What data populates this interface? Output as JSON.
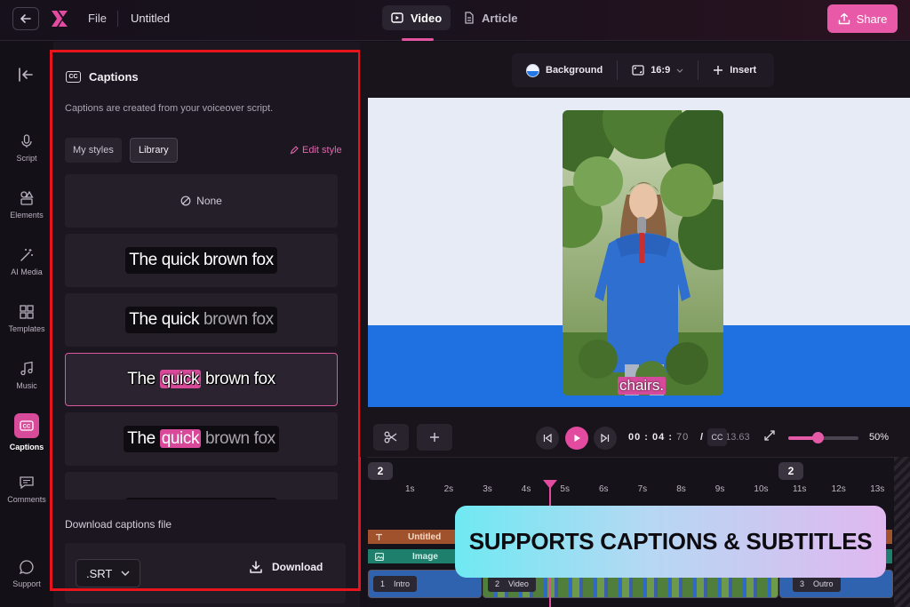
{
  "header": {
    "file_menu": "File",
    "doc_title": "Untitled",
    "tabs": [
      {
        "label": "Video",
        "active": true
      },
      {
        "label": "Article",
        "active": false
      }
    ],
    "share_label": "Share",
    "accent_color": "#e85aa7"
  },
  "rail": {
    "items": [
      {
        "label": "Script",
        "icon": "mic-icon"
      },
      {
        "label": "Elements",
        "icon": "shapes-icon"
      },
      {
        "label": "AI Media",
        "icon": "magic-wand-icon"
      },
      {
        "label": "Templates",
        "icon": "templates-icon"
      },
      {
        "label": "Music",
        "icon": "music-note-icon"
      },
      {
        "label": "Captions",
        "icon": "cc-icon",
        "active": true
      },
      {
        "label": "Comments",
        "icon": "comment-icon"
      },
      {
        "label": "Support",
        "icon": "chat-bubble-icon"
      }
    ]
  },
  "captions_panel": {
    "title": "Captions",
    "description": "Captions are created from your voiceover script.",
    "segments": [
      "My styles",
      "Library"
    ],
    "active_segment": "Library",
    "edit_style_label": "Edit style",
    "none_label": "None",
    "sample_words": [
      "The",
      "quick",
      "brown",
      "fox"
    ],
    "download_label": "Download captions file",
    "format_value": ".SRT",
    "download_button": "Download"
  },
  "canvas_toolbar": {
    "background_label": "Background",
    "aspect_ratio": "16:9",
    "insert_label": "Insert"
  },
  "canvas": {
    "subtitle": "chairs."
  },
  "playback": {
    "time_min": "00",
    "time_sec": "04",
    "time_ms": "70",
    "separator": "/",
    "total_time": "13.63",
    "zoom_percent": "50%",
    "zoom_fraction": 0.42
  },
  "timeline": {
    "markers": [
      "2",
      "2"
    ],
    "ticks": [
      "1s",
      "2s",
      "3s",
      "4s",
      "5s",
      "6s",
      "7s",
      "8s",
      "9s",
      "10s",
      "11s",
      "12s",
      "13s"
    ],
    "tracks": {
      "text_label": "Untitled",
      "image_label": "Image"
    },
    "clips": [
      {
        "index": "1",
        "label": "Intro"
      },
      {
        "index": "2",
        "label": "Video"
      },
      {
        "index": "3",
        "label": "Outro"
      }
    ]
  },
  "promo_banner": "SUPPORTS CAPTIONS & SUBTITLES"
}
